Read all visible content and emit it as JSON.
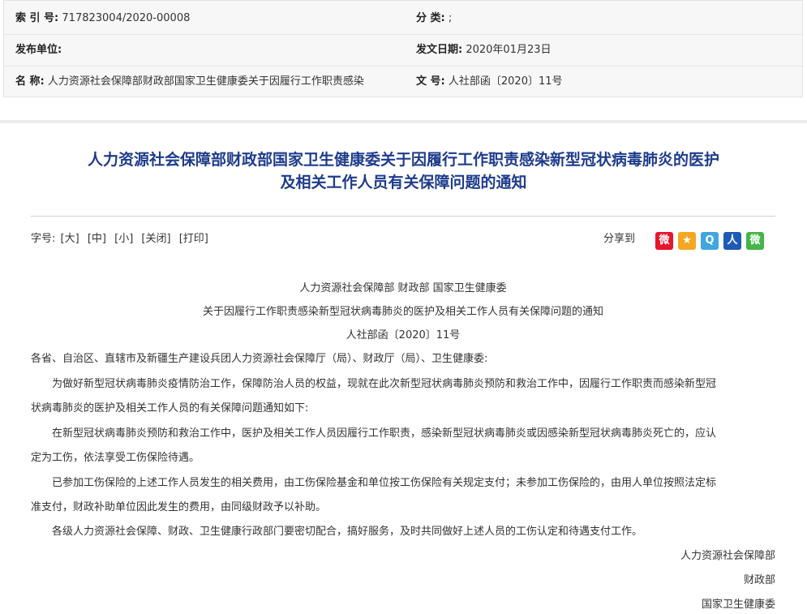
{
  "meta": {
    "index_label": "索 引 号:",
    "index_value": "717823004/2020-00008",
    "category_label": "分  类:",
    "category_value": ";",
    "publisher_label": "发布单位:",
    "publisher_value": "",
    "date_label": "发文日期:",
    "date_value": "2020年01月23日",
    "name_label": "名  称:",
    "name_value": "人力资源社会保障部财政部国家卫生健康委关于因履行工作职责感染",
    "docno_label": "文  号:",
    "docno_value": "人社部函〔2020〕11号"
  },
  "title": {
    "line1": "人力资源社会保障部财政部国家卫生健康委关于因履行工作职责感染新型冠状病毒肺炎的医护",
    "line2": "及相关工作人员有关保障问题的通知"
  },
  "toolbar": {
    "font_label": "字号:",
    "large": "[大]",
    "medium": "[中]",
    "small": "[小]",
    "close": "[关闭]",
    "print": "[打印]"
  },
  "share": {
    "label": "分享到",
    "icons": [
      {
        "name": "weibo-icon",
        "glyph": "微",
        "color": "#e6162d"
      },
      {
        "name": "qzone-icon",
        "glyph": "★",
        "color": "#f5a623"
      },
      {
        "name": "tencent-weibo-icon",
        "glyph": "Q",
        "color": "#3fa6e0"
      },
      {
        "name": "renren-icon",
        "glyph": "人",
        "color": "#1f5bb5"
      },
      {
        "name": "wechat-icon",
        "glyph": "微",
        "color": "#44b549"
      }
    ]
  },
  "doc": {
    "issuer": "人力资源社会保障部  财政部   国家卫生健康委",
    "subtitle": "关于因履行工作职责感染新型冠状病毒肺炎的医护及相关工作人员有关保障问题的通知",
    "docno": "人社部函〔2020〕11号",
    "addressee": "各省、自治区、直辖市及新疆生产建设兵团人力资源社会保障厅（局）、财政厅（局）、卫生健康委:",
    "p1_l1": "为做好新型冠状病毒肺炎疫情防治工作，保障防治人员的权益，现就在此次新型冠状病毒肺炎预防和救治工作中，因履行工作职责而感染新型冠",
    "p1_l2": "状病毒肺炎的医护及相关工作人员的有关保障问题通知如下:",
    "p2_l1": "在新型冠状病毒肺炎预防和救治工作中，医护及相关工作人员因履行工作职责，感染新型冠状病毒肺炎或因感染新型冠状病毒肺炎死亡的，应认",
    "p2_l2": "定为工伤，依法享受工伤保险待遇。",
    "p3_l1": "已参加工伤保险的上述工作人员发生的相关费用，由工伤保险基金和单位按工伤保险有关规定支付；未参加工伤保险的，由用人单位按照法定标",
    "p3_l2": "准支付，财政补助单位因此发生的费用，由同级财政予以补助。",
    "p4": "各级人力资源社会保障、财政、卫生健康行政部门要密切配合，搞好服务，及时共同做好上述人员的工伤认定和待遇支付工作。",
    "sign1": "人力资源社会保障部",
    "sign2": "财政部",
    "sign3": "国家卫生健康委"
  }
}
